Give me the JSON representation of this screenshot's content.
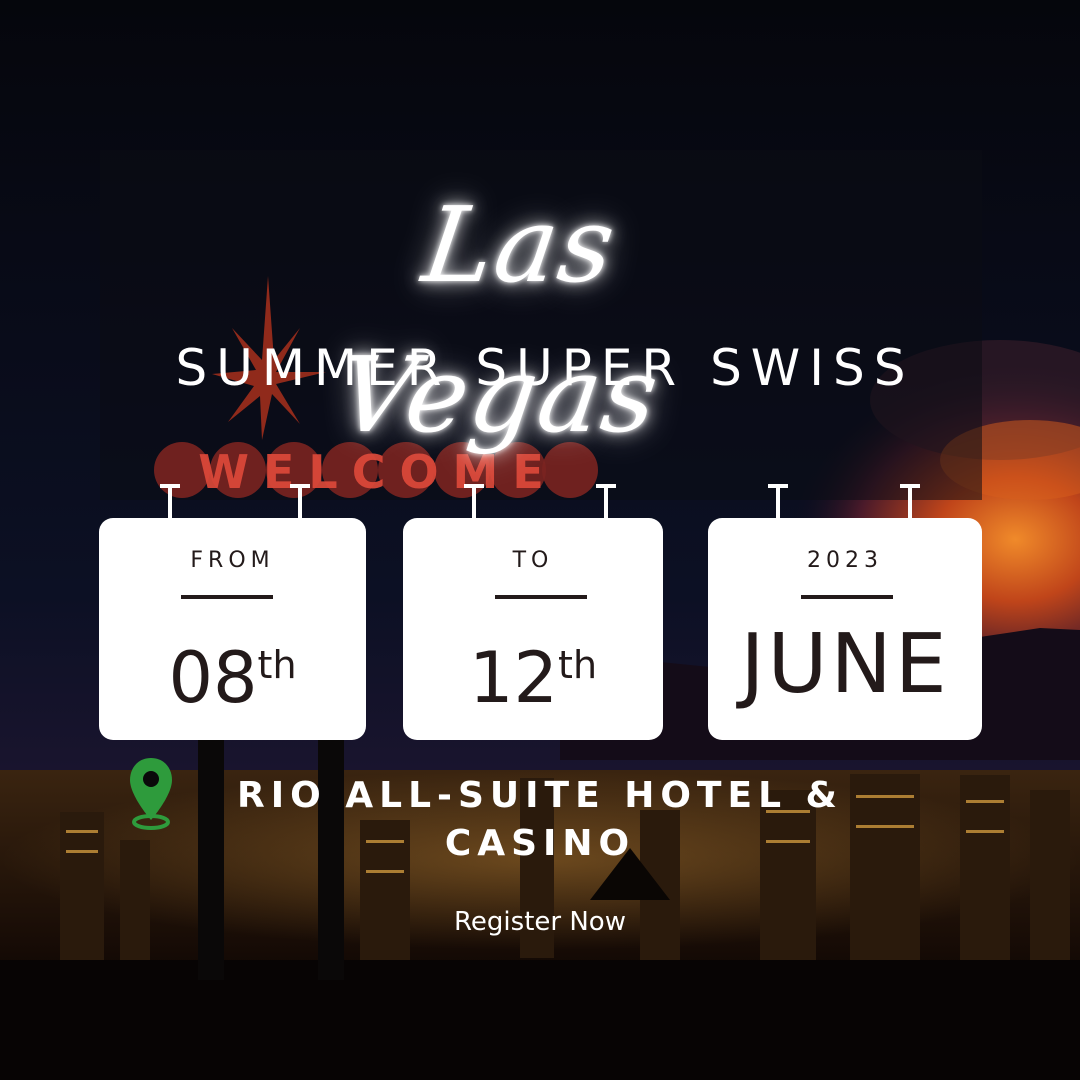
{
  "headline": {
    "script_title": "Las Vegas",
    "event_name": "SUMMER SUPER SWISS"
  },
  "background": {
    "sign_letters": "WELCOME"
  },
  "date_cards": [
    {
      "label": "FROM",
      "value": "08",
      "suffix": "th"
    },
    {
      "label": "TO",
      "value": "12",
      "suffix": "th"
    },
    {
      "label": "2023",
      "value": "JUNE"
    }
  ],
  "venue": {
    "icon": "map-pin-icon",
    "name": "RIO ALL-SUITE HOTEL & CASINO"
  },
  "cta": {
    "label": "Register Now"
  },
  "colors": {
    "card_bg": "#ffffff",
    "card_text": "#231a1a",
    "pin_green": "#2e9b3c",
    "title_glow": "#ffffff",
    "sky_orange": "#e2661d"
  }
}
